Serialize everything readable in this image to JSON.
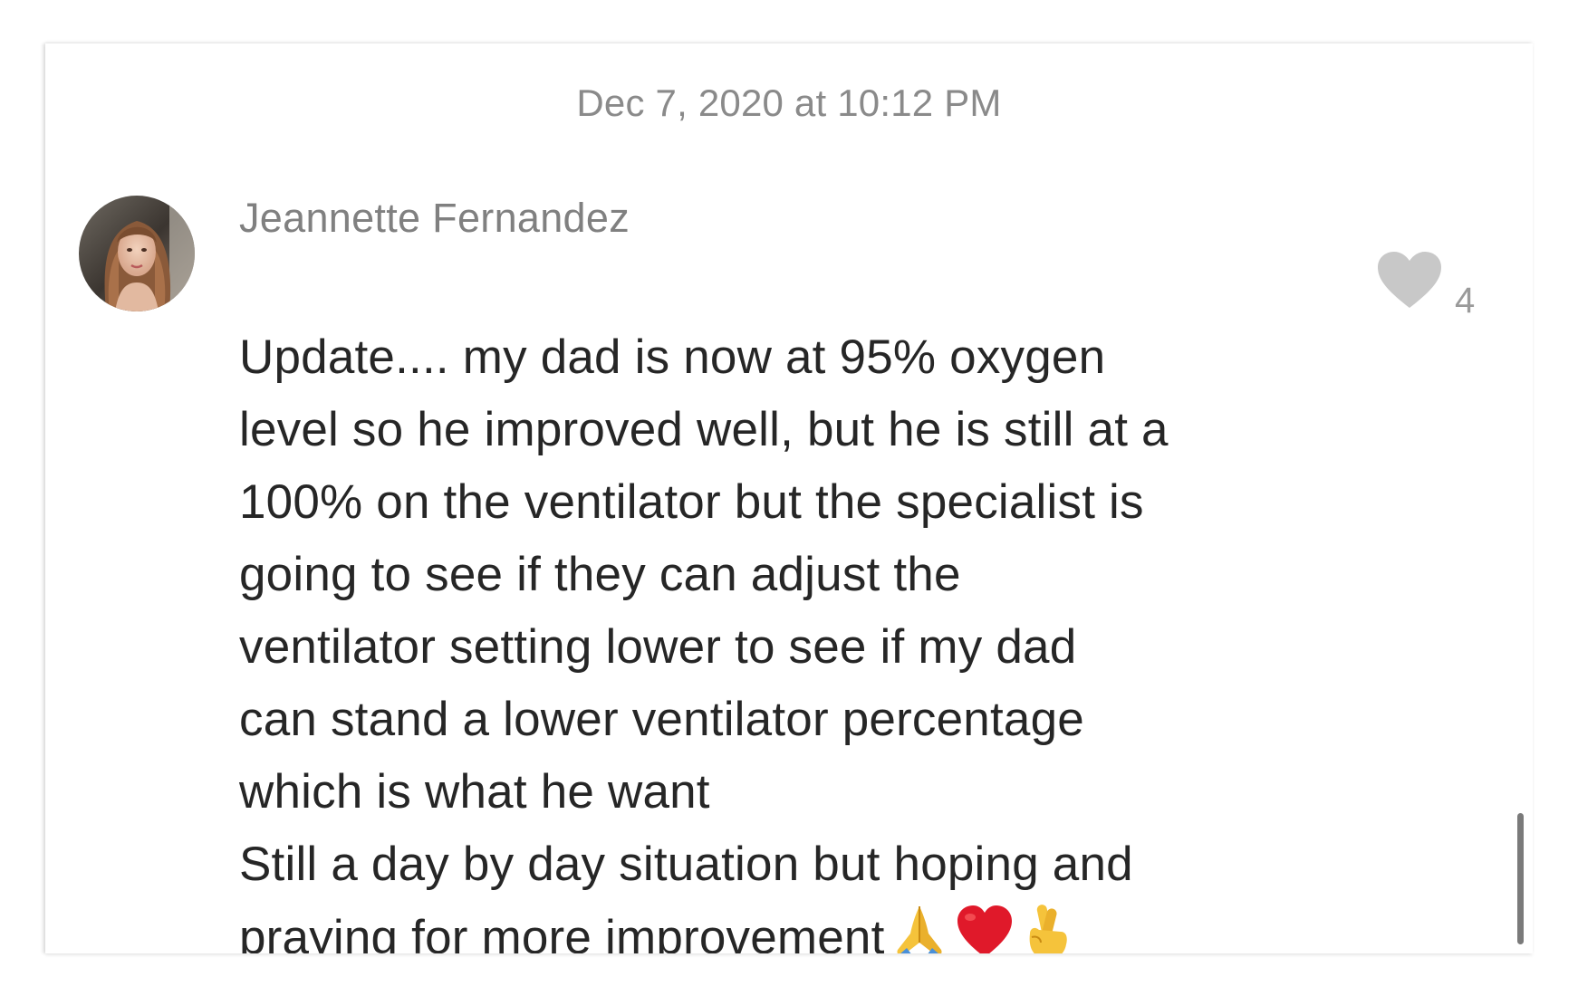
{
  "timestamp": "Dec 7, 2020 at 10:12 PM",
  "comment": {
    "author": "Jeannette Fernandez",
    "lines": [
      "Update.... my dad is now at 95% oxygen",
      "level so he improved well, but he is still at a",
      "100% on the ventilator but the specialist is",
      "going to see if they can adjust the",
      "ventilator setting lower to see if my dad",
      "can stand a lower ventilator percentage",
      "which is what he want",
      "Still a day by day situation but hoping and",
      "praying for more improvement"
    ],
    "emojis": [
      "folded-hands-icon",
      "red-heart-icon",
      "crossed-fingers-icon"
    ],
    "likes": "4"
  },
  "colors": {
    "timestamp": "#8a8a8a",
    "author": "#808080",
    "text": "#262626",
    "heart": "#c8c8c8",
    "scrollbar": "#7a7a7a"
  }
}
